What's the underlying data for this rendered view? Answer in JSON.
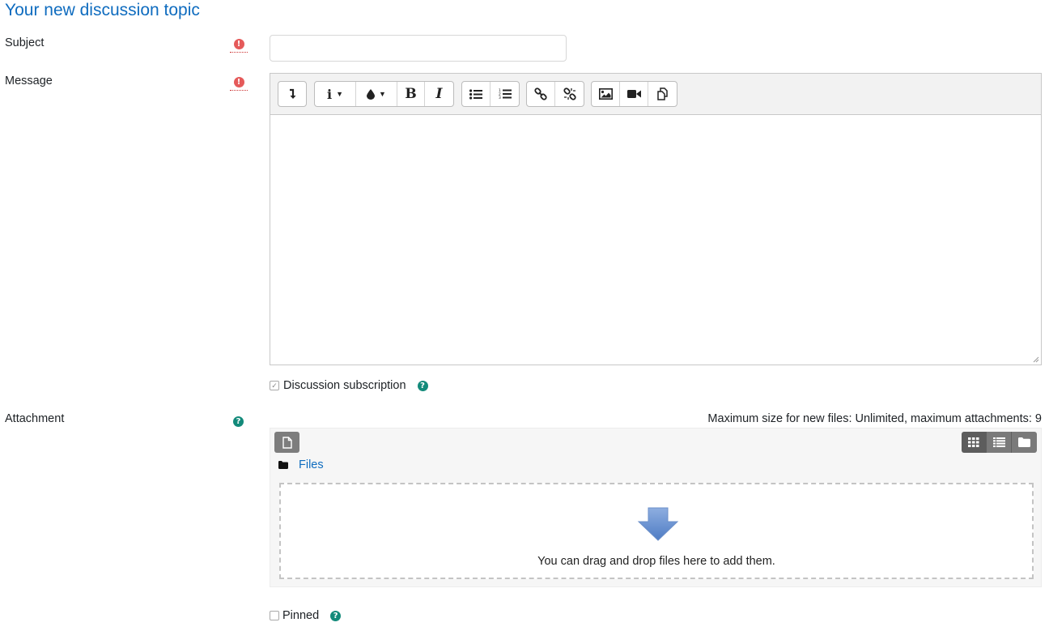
{
  "page": {
    "title": "Your new discussion topic"
  },
  "subject": {
    "label": "Subject",
    "value": ""
  },
  "message": {
    "label": "Message",
    "toolbar": {
      "show_more": "show-more-buttons-icon",
      "paragraph_styles": "info-icon",
      "font_color": "drop-icon",
      "bold": "B",
      "italic": "I",
      "unordered_list": "unordered-list-icon",
      "ordered_list": "ordered-list-icon",
      "link": "link-icon",
      "unlink": "unlink-icon",
      "image": "image-icon",
      "media": "video-icon",
      "manage_files": "files-icon"
    },
    "content": ""
  },
  "subscription": {
    "label": "Discussion subscription",
    "checked": true
  },
  "attachment": {
    "label": "Attachment",
    "limits": "Maximum size for new files: Unlimited, maximum attachments: 9",
    "path_label": "Files",
    "drop_text": "You can drag and drop files here to add them."
  },
  "pinned": {
    "label": "Pinned",
    "checked": false
  },
  "colors": {
    "accent": "#0f6cbf",
    "required": "#e55a5a",
    "help": "#138a7a"
  }
}
